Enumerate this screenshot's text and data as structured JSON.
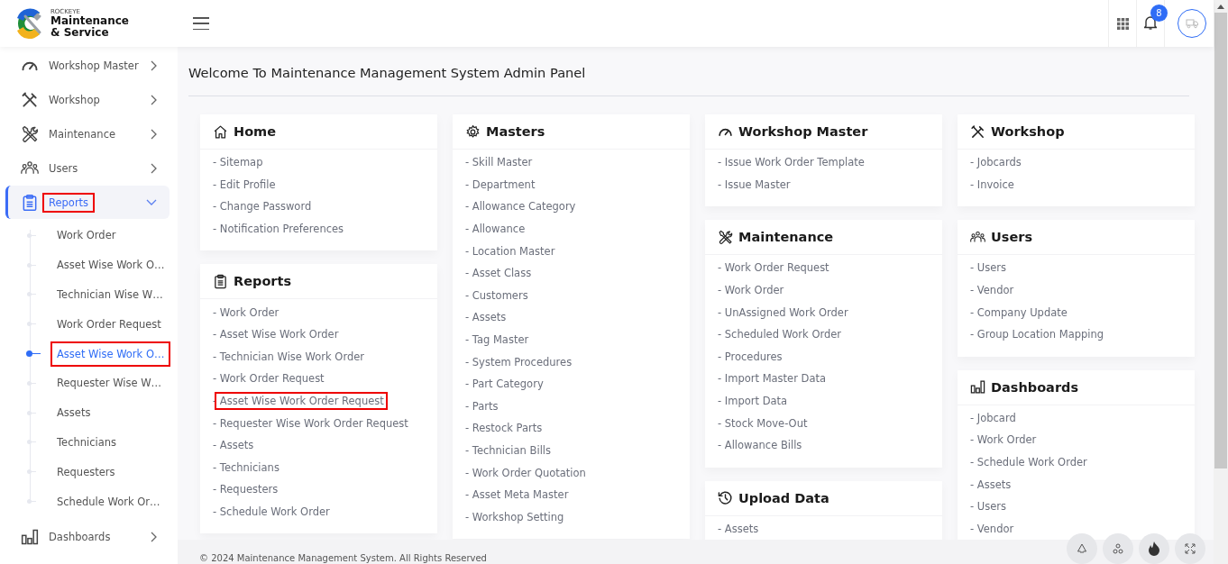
{
  "header": {
    "brand_small": "ROCKEYE",
    "brand_line1": "Maintenance",
    "brand_line2": "& Service",
    "notification_count": "8"
  },
  "sidebar": {
    "items": [
      {
        "label": "Workshop Master",
        "selected": false,
        "expanded": false,
        "highlighted": false
      },
      {
        "label": "Workshop",
        "selected": false,
        "expanded": false,
        "highlighted": false
      },
      {
        "label": "Maintenance",
        "selected": false,
        "expanded": false,
        "highlighted": false
      },
      {
        "label": "Users",
        "selected": false,
        "expanded": false,
        "highlighted": false
      },
      {
        "label": "Reports",
        "selected": true,
        "expanded": true,
        "highlighted": true,
        "children": [
          {
            "label": "Work Order",
            "selected": false,
            "highlighted": false
          },
          {
            "label": "Asset Wise Work O…",
            "selected": false,
            "highlighted": false
          },
          {
            "label": "Technician Wise W…",
            "selected": false,
            "highlighted": false
          },
          {
            "label": "Work Order Request",
            "selected": false,
            "highlighted": false
          },
          {
            "label": "Asset Wise Work O…",
            "selected": true,
            "highlighted": true
          },
          {
            "label": "Requester Wise W…",
            "selected": false,
            "highlighted": false
          },
          {
            "label": "Assets",
            "selected": false,
            "highlighted": false
          },
          {
            "label": "Technicians",
            "selected": false,
            "highlighted": false
          },
          {
            "label": "Requesters",
            "selected": false,
            "highlighted": false
          },
          {
            "label": "Schedule Work Or…",
            "selected": false,
            "highlighted": false
          }
        ]
      },
      {
        "label": "Dashboards",
        "selected": false,
        "expanded": false,
        "highlighted": false
      }
    ]
  },
  "page_title": "Welcome To Maintenance Management System Admin Panel",
  "columns": [
    [
      {
        "title": "Home",
        "links": [
          {
            "label": "- Sitemap",
            "highlighted": false
          },
          {
            "label": "- Edit Profile",
            "highlighted": false
          },
          {
            "label": "- Change Password",
            "highlighted": false
          },
          {
            "label": "- Notification Preferences",
            "highlighted": false
          }
        ]
      },
      {
        "title": "Reports",
        "links": [
          {
            "label": "- Work Order",
            "highlighted": false
          },
          {
            "label": "- Asset Wise Work Order",
            "highlighted": false
          },
          {
            "label": "- Technician Wise Work Order",
            "highlighted": false
          },
          {
            "label": "- Work Order Request",
            "highlighted": false
          },
          {
            "label": "- Asset Wise Work Order Request",
            "highlighted": true
          },
          {
            "label": "- Requester Wise Work Order Request",
            "highlighted": false
          },
          {
            "label": "- Assets",
            "highlighted": false
          },
          {
            "label": "- Technicians",
            "highlighted": false
          },
          {
            "label": "- Requesters",
            "highlighted": false
          },
          {
            "label": "- Schedule Work Order",
            "highlighted": false
          }
        ]
      }
    ],
    [
      {
        "title": "Masters",
        "links": [
          {
            "label": "- Skill Master",
            "highlighted": false
          },
          {
            "label": "- Department",
            "highlighted": false
          },
          {
            "label": "- Allowance Category",
            "highlighted": false
          },
          {
            "label": "- Allowance",
            "highlighted": false
          },
          {
            "label": "- Location Master",
            "highlighted": false
          },
          {
            "label": "- Asset Class",
            "highlighted": false
          },
          {
            "label": "- Customers",
            "highlighted": false
          },
          {
            "label": "- Assets",
            "highlighted": false
          },
          {
            "label": "- Tag Master",
            "highlighted": false
          },
          {
            "label": "- System Procedures",
            "highlighted": false
          },
          {
            "label": "- Part Category",
            "highlighted": false
          },
          {
            "label": "- Parts",
            "highlighted": false
          },
          {
            "label": "- Restock Parts",
            "highlighted": false
          },
          {
            "label": "- Technician Bills",
            "highlighted": false
          },
          {
            "label": "- Work Order Quotation",
            "highlighted": false
          },
          {
            "label": "- Asset Meta Master",
            "highlighted": false
          },
          {
            "label": "- Workshop Setting",
            "highlighted": false
          }
        ]
      }
    ],
    [
      {
        "title": "Workshop Master",
        "links": [
          {
            "label": "- Issue Work Order Template",
            "highlighted": false
          },
          {
            "label": "- Issue Master",
            "highlighted": false
          }
        ]
      },
      {
        "title": "Maintenance",
        "links": [
          {
            "label": "- Work Order Request",
            "highlighted": false
          },
          {
            "label": "- Work Order",
            "highlighted": false
          },
          {
            "label": "- UnAssigned Work Order",
            "highlighted": false
          },
          {
            "label": "- Scheduled Work Order",
            "highlighted": false
          },
          {
            "label": "- Procedures",
            "highlighted": false
          },
          {
            "label": "- Import Master Data",
            "highlighted": false
          },
          {
            "label": "- Import Data",
            "highlighted": false
          },
          {
            "label": "- Stock Move-Out",
            "highlighted": false
          },
          {
            "label": "- Allowance Bills",
            "highlighted": false
          }
        ]
      },
      {
        "title": "Upload Data",
        "links": [
          {
            "label": "- Assets",
            "highlighted": false
          }
        ]
      }
    ],
    [
      {
        "title": "Workshop",
        "links": [
          {
            "label": "- Jobcards",
            "highlighted": false
          },
          {
            "label": "- Invoice",
            "highlighted": false
          }
        ]
      },
      {
        "title": "Users",
        "links": [
          {
            "label": "- Users",
            "highlighted": false
          },
          {
            "label": "- Vendor",
            "highlighted": false
          },
          {
            "label": "- Company Update",
            "highlighted": false
          },
          {
            "label": "- Group Location Mapping",
            "highlighted": false
          }
        ]
      },
      {
        "title": "Dashboards",
        "links": [
          {
            "label": "- Jobcard",
            "highlighted": false
          },
          {
            "label": "- Work Order",
            "highlighted": false
          },
          {
            "label": "- Schedule Work Order",
            "highlighted": false
          },
          {
            "label": "- Assets",
            "highlighted": false
          },
          {
            "label": "- Users",
            "highlighted": false
          },
          {
            "label": "- Vendor",
            "highlighted": false
          }
        ]
      }
    ]
  ],
  "footer": "© 2024 Maintenance Management System. All Rights Reserved"
}
